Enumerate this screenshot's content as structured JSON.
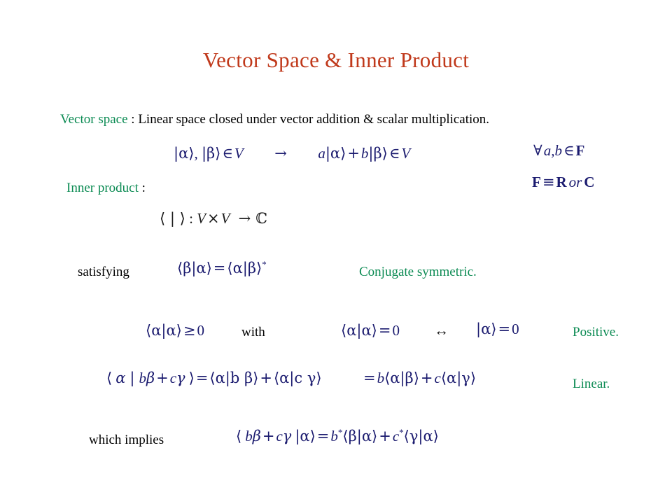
{
  "slide": {
    "title": "Vector Space & Inner Product",
    "colors": {
      "title_red": "#C0391B",
      "accent_green": "#0A8A52",
      "math_navy": "#1B1B6F",
      "body_black": "#000000",
      "background": "#FFFFFF"
    }
  },
  "definitions": {
    "vector_space_label": "Vector space",
    "vector_space_colon": " : ",
    "vector_space_text": "Linear space closed under vector addition & scalar multiplication.",
    "inner_product_label": "Inner product",
    "inner_product_colon": " :"
  },
  "labels": {
    "satisfying": "satisfying",
    "conjugate_symmetric": "Conjugate symmetric.",
    "with": "with",
    "positive": "Positive.",
    "linear": "Linear.",
    "which_implies": "which implies"
  },
  "equations": {
    "closure": {
      "lhs_ket_alpha": "|α⟩",
      "comma": ", ",
      "lhs_ket_beta": "|β⟩",
      "in": "∈",
      "space_V": "V",
      "arrow": "→",
      "rhs_a": "a",
      "rhs_ket_alpha": "|α⟩",
      "plus": "+",
      "rhs_b": "b",
      "rhs_ket_beta": "|β⟩",
      "rhs_in": "∈",
      "rhs_V": "V",
      "plain": "|α⟩, |β⟩ ∈ V  →  a|α⟩ + b|β⟩ ∈ V"
    },
    "forall_ab": {
      "forall": "∀",
      "vars": "a,b",
      "in": "∈",
      "field": "F",
      "plain": "∀ a,b ∈ F"
    },
    "field_def": {
      "field": "F",
      "equiv": "≡",
      "reals": "R",
      "or": "or",
      "complex": "C",
      "plain": "F ≡ R or C"
    },
    "ip_map": {
      "bracket": "⟨ | ⟩",
      "colon": " : ",
      "V1": "V",
      "times": "×",
      "V2": "V",
      "arrow": "→",
      "target": "ℂ",
      "plain": "⟨ | ⟩ : V × V → ℂ"
    },
    "conjugate_symmetry": {
      "lhs": "⟨β|α⟩",
      "eq": "=",
      "rhs": "⟨α|β⟩",
      "star": "*",
      "plain": "⟨β|α⟩ = ⟨α|β⟩*"
    },
    "positivity_1": {
      "bracket": "⟨α|α⟩",
      "geq": "≥",
      "zero": "0",
      "plain": "⟨α|α⟩ ≥ 0"
    },
    "positivity_2": {
      "bracket": "⟨α|α⟩",
      "eq": "=",
      "zero": "0",
      "plain": "⟨α|α⟩ = 0"
    },
    "iff": "↔",
    "positivity_3": {
      "ket": "|α⟩",
      "eq": "=",
      "zero": "0",
      "plain": "|α⟩ = 0"
    },
    "linearity": {
      "lhs_open": "⟨",
      "lhs_alpha": "α",
      "lhs_bar": "|",
      "lhs_b": "b",
      "lhs_beta": "β",
      "lhs_plus": "+",
      "lhs_c": "c",
      "lhs_gamma": "γ",
      "lhs_close": "⟩",
      "eq1": "=",
      "t1": "⟨α|b β⟩",
      "plus": "+",
      "t2": "⟨α|c γ⟩",
      "plain": "⟨ α | bβ + cγ ⟩ = ⟨α|b β⟩ + ⟨α|c γ⟩"
    },
    "linearity_cont": {
      "eq": "=",
      "b": "b",
      "t1": "⟨α|β⟩",
      "plus": "+",
      "c": "c",
      "t2": "⟨α|γ⟩",
      "plain": "= b⟨α|β⟩ + c⟨α|γ⟩"
    },
    "antilinearity": {
      "open": "⟨",
      "b": "b",
      "beta": "β",
      "plus1": "+",
      "c": "c",
      "gamma": "γ",
      "bar_ket": "|α⟩",
      "eq": "=",
      "bstar": "b",
      "star1": "*",
      "t1": "⟨β|α⟩",
      "plus2": "+",
      "cstar": "c",
      "star2": "*",
      "t2": "⟨γ|α⟩",
      "plain": "⟨ bβ + cγ |α⟩ = b*⟨β|α⟩ + c*⟨γ|α⟩"
    }
  }
}
